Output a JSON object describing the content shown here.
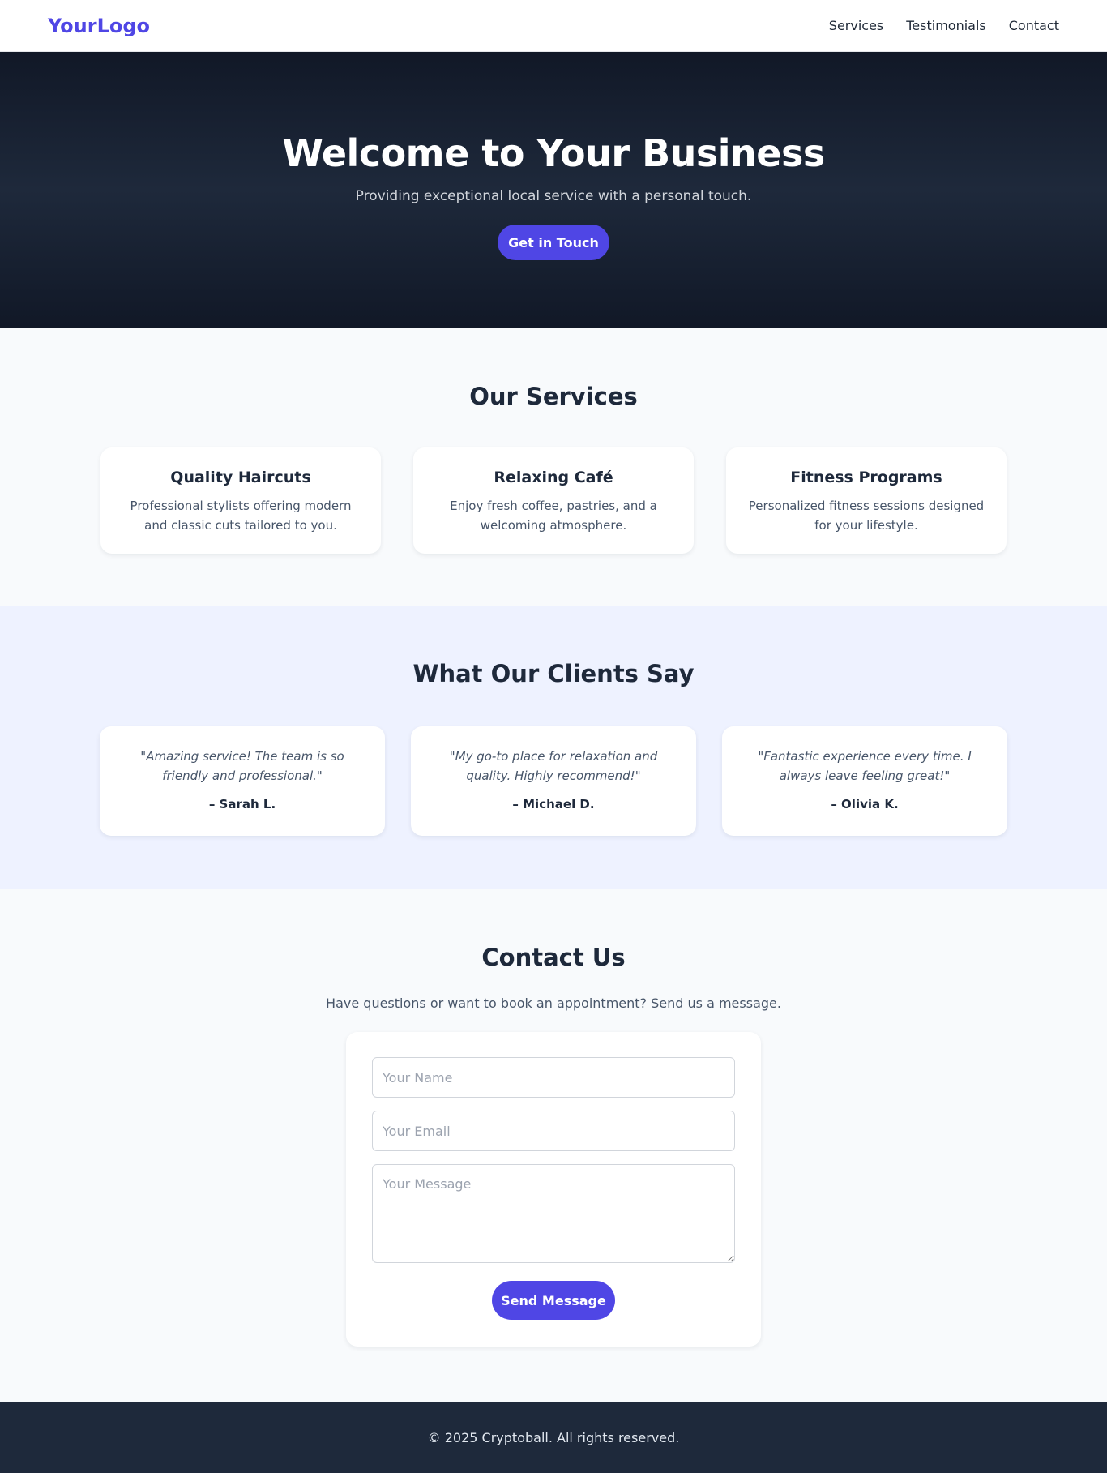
{
  "header": {
    "logo": "YourLogo",
    "nav": [
      "Services",
      "Testimonials",
      "Contact"
    ]
  },
  "hero": {
    "title": "Welcome to Your Business",
    "subtitle": "Providing exceptional local service with a personal touch.",
    "cta": "Get in Touch"
  },
  "services": {
    "title": "Our Services",
    "items": [
      {
        "title": "Quality Haircuts",
        "desc": "Professional stylists offering modern and classic cuts tailored to you."
      },
      {
        "title": "Relaxing Café",
        "desc": "Enjoy fresh coffee, pastries, and a welcoming atmosphere."
      },
      {
        "title": "Fitness Programs",
        "desc": "Personalized fitness sessions designed for your lifestyle."
      }
    ]
  },
  "testimonials": {
    "title": "What Our Clients Say",
    "items": [
      {
        "quote": "\"Amazing service! The team is so friendly and professional.\"",
        "author": "– Sarah L."
      },
      {
        "quote": "\"My go-to place for relaxation and quality. Highly recommend!\"",
        "author": "– Michael D."
      },
      {
        "quote": "\"Fantastic experience every time. I always leave feeling great!\"",
        "author": "– Olivia K."
      }
    ]
  },
  "contact": {
    "title": "Contact Us",
    "subtitle": "Have questions or want to book an appointment? Send us a message.",
    "name_placeholder": "Your Name",
    "email_placeholder": "Your Email",
    "message_placeholder": "Your Message",
    "submit": "Send Message"
  },
  "footer": {
    "text": "© 2025 Cryptoball. All rights reserved."
  },
  "colors": {
    "accent": "#4f46e5",
    "hero_bg": "#111827",
    "testimonials_bg": "#eef2ff",
    "footer_bg": "#1e293b"
  }
}
